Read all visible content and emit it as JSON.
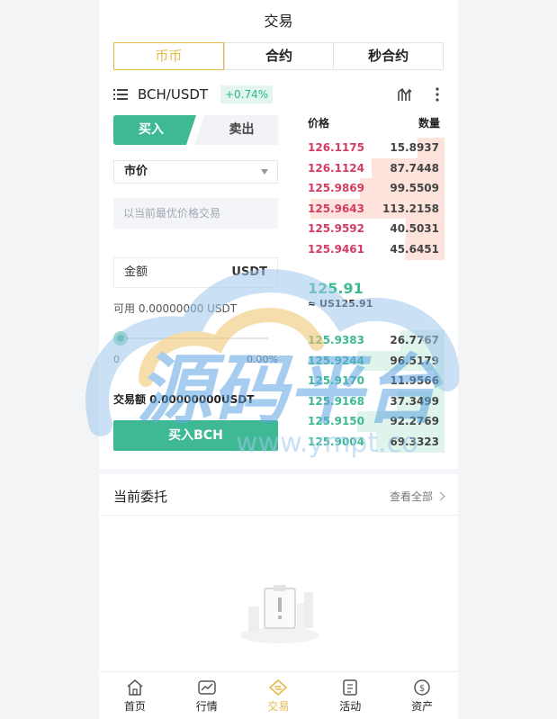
{
  "header": {
    "title": "交易"
  },
  "segments": [
    {
      "label": "币币",
      "active": true
    },
    {
      "label": "合约",
      "active": false
    },
    {
      "label": "秒合约",
      "active": false
    }
  ],
  "pair": {
    "name": "BCH/USDT",
    "change": "+0.74%"
  },
  "order_form": {
    "buy_tab": "买入",
    "sell_tab": "卖出",
    "order_type": "市价",
    "price_hint": "以当前最优价格交易",
    "amount_label": "金额",
    "amount_unit": "USDT",
    "available": "可用 0.00000000 USDT",
    "slider": {
      "value_percent": 0,
      "min_label": "0",
      "max_label": "0.00%"
    },
    "trade_total": "交易额 0.00000000USDT",
    "submit_label": "买入BCH"
  },
  "order_book": {
    "price_header": "价格",
    "qty_header": "数量",
    "asks": [
      {
        "price": "126.1175",
        "qty": "15.8937",
        "depth": 0.2
      },
      {
        "price": "126.1124",
        "qty": "87.7448",
        "depth": 0.53
      },
      {
        "price": "125.9869",
        "qty": "99.5509",
        "depth": 0.62
      },
      {
        "price": "125.9643",
        "qty": "113.2158",
        "depth": 0.98
      },
      {
        "price": "125.9592",
        "qty": "40.5031",
        "depth": 0.28
      },
      {
        "price": "125.9461",
        "qty": "45.6451",
        "depth": 0.29
      }
    ],
    "last_price": "125.91",
    "last_price_usd": "≈ US125.91",
    "bids": [
      {
        "price": "125.9383",
        "qty": "26.7767",
        "depth": 0.32
      },
      {
        "price": "125.9244",
        "qty": "96.5179",
        "depth": 0.64
      },
      {
        "price": "125.9170",
        "qty": "11.9566",
        "depth": 0.08
      },
      {
        "price": "125.9168",
        "qty": "37.3499",
        "depth": 0.35
      },
      {
        "price": "125.9150",
        "qty": "92.2769",
        "depth": 0.64
      },
      {
        "price": "125.9004",
        "qty": "69.3323",
        "depth": 0.5
      }
    ]
  },
  "orders": {
    "title": "当前委托",
    "view_all": "查看全部"
  },
  "tabbar": [
    {
      "label": "首页",
      "icon": "home-icon",
      "active": false
    },
    {
      "label": "行情",
      "icon": "market-icon",
      "active": false
    },
    {
      "label": "交易",
      "icon": "trade-icon",
      "active": true
    },
    {
      "label": "活动",
      "icon": "activity-icon",
      "active": false
    },
    {
      "label": "资产",
      "icon": "assets-icon",
      "active": false
    }
  ],
  "watermark": {
    "text": "源码平台",
    "subtext": "www.ympt.co"
  },
  "colors": {
    "accent": "#e8b84a",
    "buy": "#3fb994",
    "sell": "#d33c62"
  }
}
